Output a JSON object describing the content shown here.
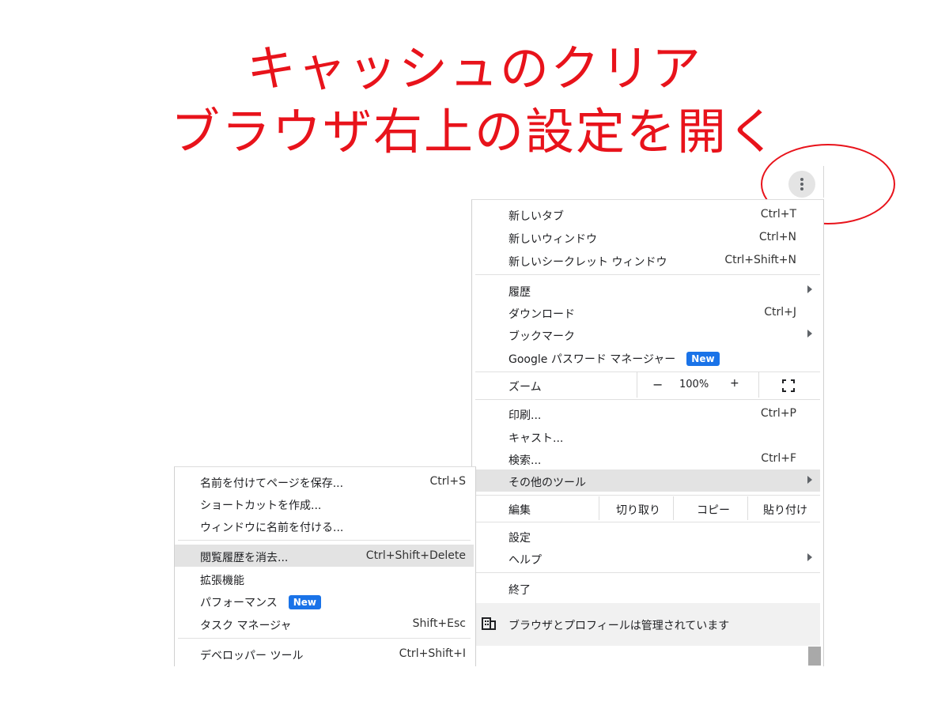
{
  "slide": {
    "title_line1": "キャッシュのクリア",
    "title_line2": "ブラウザ右上の設定を開く"
  },
  "colors": {
    "annotation": "#e8131b",
    "badge": "#1a73e8",
    "selected_row": "#e3e3e3"
  },
  "menu_button": {
    "icon": "three-dots-vertical-icon"
  },
  "main_menu": {
    "new_tab": {
      "label": "新しいタブ",
      "shortcut": "Ctrl+T"
    },
    "new_window": {
      "label": "新しいウィンドウ",
      "shortcut": "Ctrl+N"
    },
    "incognito": {
      "label": "新しいシークレット ウィンドウ",
      "shortcut": "Ctrl+Shift+N"
    },
    "history": {
      "label": "履歴"
    },
    "downloads": {
      "label": "ダウンロード",
      "shortcut": "Ctrl+J"
    },
    "bookmarks": {
      "label": "ブックマーク"
    },
    "password_manager": {
      "label": "Google パスワード マネージャー",
      "badge": "New"
    },
    "zoom": {
      "label": "ズーム",
      "minus": "−",
      "value": "100%",
      "plus": "+",
      "fullscreen_icon": "fullscreen-icon"
    },
    "print": {
      "label": "印刷...",
      "shortcut": "Ctrl+P"
    },
    "cast": {
      "label": "キャスト..."
    },
    "find": {
      "label": "検索...",
      "shortcut": "Ctrl+F"
    },
    "more_tools": {
      "label": "その他のツール"
    },
    "edit": {
      "label": "編集",
      "cut": "切り取り",
      "copy": "コピー",
      "paste": "貼り付け"
    },
    "settings": {
      "label": "設定"
    },
    "help": {
      "label": "ヘルプ"
    },
    "exit": {
      "label": "終了"
    },
    "managed": {
      "label": "ブラウザとプロフィールは管理されています",
      "icon": "building-icon"
    }
  },
  "sub_menu": {
    "save_page": {
      "label": "名前を付けてページを保存...",
      "shortcut": "Ctrl+S"
    },
    "create_shortcut": {
      "label": "ショートカットを作成..."
    },
    "name_window": {
      "label": "ウィンドウに名前を付ける..."
    },
    "clear_data": {
      "label": "閲覧履歴を消去...",
      "shortcut": "Ctrl+Shift+Delete"
    },
    "extensions": {
      "label": "拡張機能"
    },
    "performance": {
      "label": "パフォーマンス",
      "badge": "New"
    },
    "task_manager": {
      "label": "タスク マネージャ",
      "shortcut": "Shift+Esc"
    },
    "dev_tools": {
      "label": "デベロッパー ツール",
      "shortcut": "Ctrl+Shift+I"
    }
  }
}
